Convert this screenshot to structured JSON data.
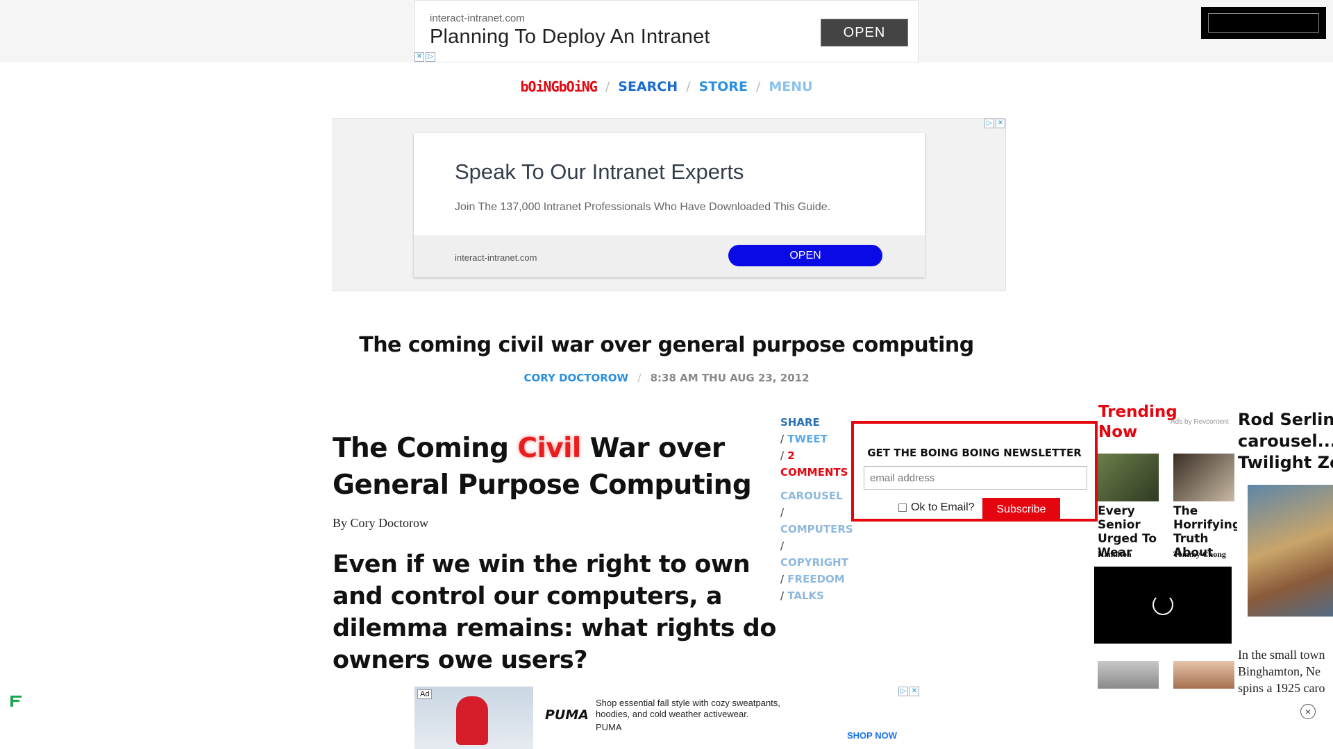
{
  "top_ad": {
    "domain": "interact-intranet.com",
    "headline": "Planning To Deploy An Intranet",
    "button": "OPEN"
  },
  "nav": {
    "logo": "bOiNGbOiNG",
    "search": "SEARCH",
    "store": "STORE",
    "menu": "MENU",
    "separator": "/"
  },
  "big_ad": {
    "title": "Speak To Our Intranet Experts",
    "description": "Join The 137,000 Intranet Professionals Who Have Downloaded This Guide.",
    "domain": "interact-intranet.com",
    "button": "OPEN"
  },
  "post": {
    "title": "The coming civil war over general purpose computing",
    "author": "CORY DOCTOROW",
    "timestamp": "8:38 AM THU AUG 23, 2012"
  },
  "article": {
    "heading_part1": "The Coming ",
    "heading_highlight": "Civil",
    "heading_part2": " War over General Purpose Computing",
    "byline": "By Cory Doctorow",
    "lead": "Even if we win the right to own and control our computers, a dilemma remains: what rights do owners owe users?"
  },
  "share": {
    "label": "SHARE",
    "tweet": "TWEET",
    "comments_count": "2",
    "comments": "COMMENTS",
    "tags": [
      "CAROUSEL",
      "COMPUTERS",
      "COPYRIGHT",
      "FREEDOM",
      "TALKS"
    ]
  },
  "newsletter": {
    "title": "GET THE BOING BOING NEWSLETTER",
    "placeholder": "email address",
    "ok_label": "Ok to Email?",
    "subscribe": "Subscribe"
  },
  "trending": {
    "title": "Trending Now",
    "ads_by": "Ads by Revcontent",
    "items": [
      {
        "caption": "Every Senior Urged To Wear This",
        "source": "Hamilton"
      },
      {
        "caption": "The Horrifying Truth About CBD",
        "source": "Tommy Chong"
      }
    ]
  },
  "rod": {
    "title_lines": [
      "Rod Serling",
      "carousel... in",
      "Twilight Zon"
    ],
    "text_lines": [
      "In the small town",
      "Binghamton, Ne",
      "spins a 1925 caro"
    ]
  },
  "bottom_ad": {
    "ad_label": "Ad",
    "brand_logo": "PUMA",
    "text": "Shop essential fall style with cozy sweatpants, hoodies, and cold weather activewear.",
    "brand": "PUMA",
    "cta": "SHOP NOW"
  },
  "misc": {
    "close": "×"
  }
}
